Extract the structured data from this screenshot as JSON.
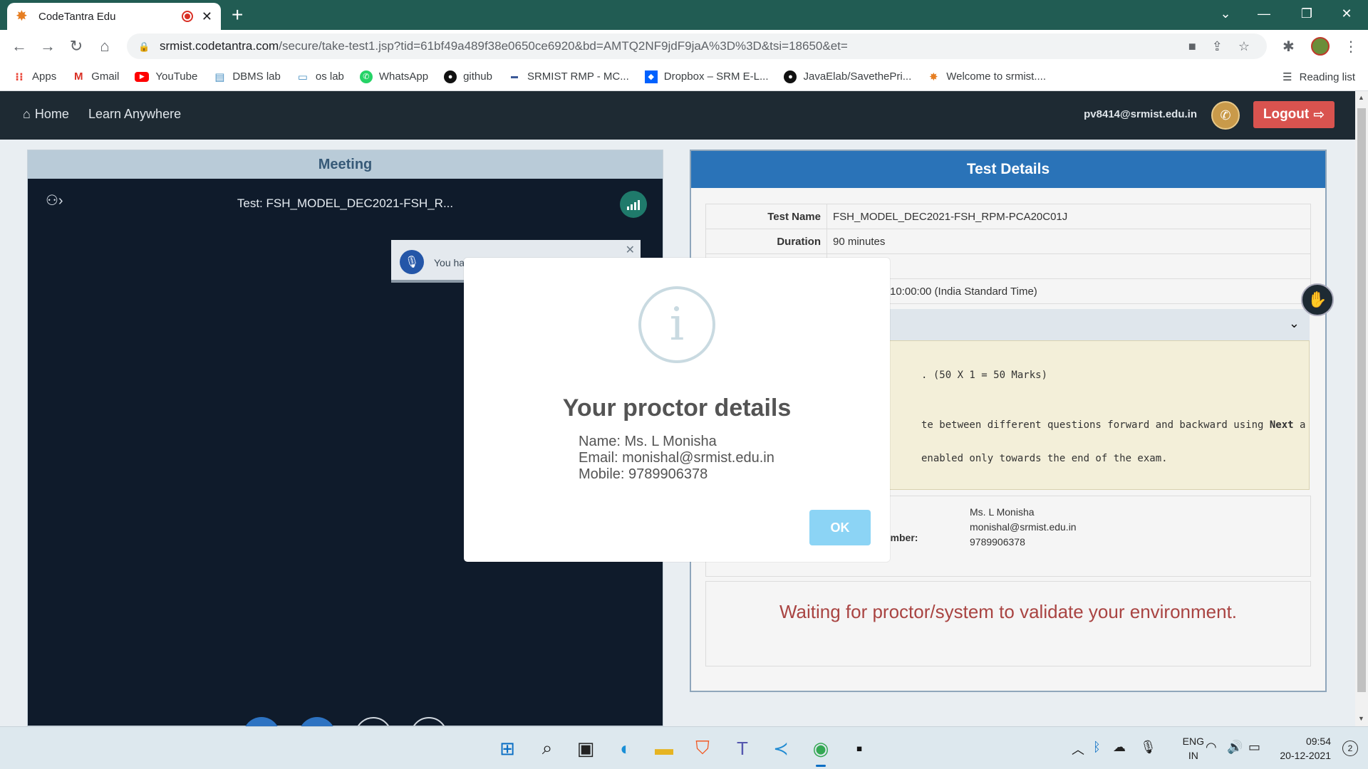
{
  "browser": {
    "tab_title": "CodeTantra Edu",
    "url_host": "srmist.codetantra.com",
    "url_path": "/secure/take-test1.jsp?tid=61bf49a489f38e0650ce6920&bd=AMTQ2NF9jdF9jaA%3D%3D&tsi=18650&et=",
    "bookmarks": [
      {
        "label": "Apps",
        "icon": "apps-grid-icon"
      },
      {
        "label": "Gmail",
        "icon": "gmail-icon"
      },
      {
        "label": "YouTube",
        "icon": "youtube-icon"
      },
      {
        "label": "DBMS lab",
        "icon": "dbms-icon"
      },
      {
        "label": "os lab",
        "icon": "monitor-icon"
      },
      {
        "label": "WhatsApp",
        "icon": "whatsapp-icon"
      },
      {
        "label": "github",
        "icon": "github-icon"
      },
      {
        "label": "SRMIST RMP - MC...",
        "icon": "srm-icon"
      },
      {
        "label": "Dropbox – SRM E-L...",
        "icon": "dropbox-icon"
      },
      {
        "label": "JavaElab/SavethePri...",
        "icon": "github-icon"
      },
      {
        "label": "Welcome to srmist....",
        "icon": "sun-icon"
      }
    ],
    "reading_list": "Reading list"
  },
  "nav": {
    "home": "Home",
    "learn": "Learn Anywhere",
    "email": "pv8414@srmist.edu.in",
    "logout": "Logout"
  },
  "meeting": {
    "header": "Meeting",
    "title": "Test: FSH_MODEL_DEC2021-FSH_R...",
    "notification": "You ha"
  },
  "details": {
    "header": "Test Details",
    "rows": [
      {
        "key": "Test Name",
        "value": "FSH_MODEL_DEC2021-FSH_RPM-PCA20C01J"
      },
      {
        "key": "Duration",
        "value": "90 minutes"
      },
      {
        "key": "",
        "value": ""
      },
      {
        "key": "",
        "value": "10:00:00 (India Standard Time)"
      }
    ],
    "instructions": [
      ". (50 X 1 = 50 Marks)",
      "te between different questions forward and backward using Next a",
      " enabled only towards the end of the exam."
    ],
    "instructions_bold": "Next",
    "proctor_label": "umber:",
    "proctor_name": "Ms. L Monisha",
    "proctor_email": "monishal@srmist.edu.in",
    "proctor_mobile": "9789906378",
    "waiting": "Waiting for proctor/system to validate your environment."
  },
  "modal": {
    "title": "Your proctor details",
    "name": "Name: Ms. L Monisha",
    "email": "Email: monishal@srmist.edu.in",
    "mobile": "Mobile: 9789906378",
    "ok": "OK"
  },
  "taskbar": {
    "lang1": "ENG",
    "lang2": "IN",
    "time": "09:54",
    "date": "20-12-2021",
    "badge": "2"
  },
  "colors": {
    "tabbar": "#215c53",
    "appnav": "#1e2a33",
    "details_header": "#2a73b8",
    "logout": "#d9534f",
    "ok_button": "#8cd4f5",
    "waiting_text": "#a94442"
  }
}
